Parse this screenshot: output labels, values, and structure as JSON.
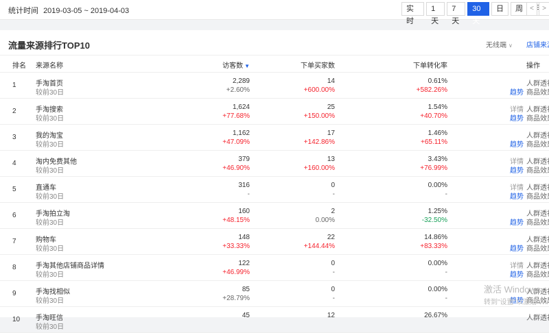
{
  "topbar": {
    "time_label": "统计时间",
    "time_range": "2019-03-05 ~ 2019-04-03",
    "range_buttons": [
      {
        "label": "实 时",
        "active": false
      },
      {
        "label": "1天",
        "active": false
      },
      {
        "label": "7天",
        "active": false
      },
      {
        "label": "30天",
        "active": true
      },
      {
        "label": "日",
        "active": false
      },
      {
        "label": "周",
        "active": false
      },
      {
        "label": "月",
        "active": false
      }
    ],
    "prev_arrow": "<",
    "next_arrow": ">"
  },
  "panel": {
    "title": "流量来源排行TOP10",
    "device_select": "无线端",
    "store_link": "店铺来源"
  },
  "table": {
    "headers": {
      "rank": "排名",
      "source": "来源名称",
      "visitors": "访客数",
      "buyers": "下单买家数",
      "conversion": "下单转化率",
      "ops": "操作"
    },
    "rows": [
      {
        "rank": "1",
        "name": "手淘首页",
        "sub": "较前30日",
        "visitors": "2,289",
        "visitors_change": "+2.60%",
        "visitors_trend": "neutral",
        "buyers": "14",
        "buyers_change": "+600.00%",
        "buyers_trend": "up",
        "conv": "0.61%",
        "conv_change": "+582.26%",
        "conv_trend": "up",
        "op_detail": "",
        "op_trend": "趋势",
        "op_crowd": "人群透视",
        "op_goods": "商品效果"
      },
      {
        "rank": "2",
        "name": "手淘搜索",
        "sub": "较前30日",
        "visitors": "1,624",
        "visitors_change": "+77.68%",
        "visitors_trend": "up",
        "buyers": "25",
        "buyers_change": "+150.00%",
        "buyers_trend": "up",
        "conv": "1.54%",
        "conv_change": "+40.70%",
        "conv_trend": "up",
        "op_detail": "详情",
        "op_trend": "趋势",
        "op_crowd": "人群透视",
        "op_goods": "商品效果"
      },
      {
        "rank": "3",
        "name": "我的淘宝",
        "sub": "较前30日",
        "visitors": "1,162",
        "visitors_change": "+47.09%",
        "visitors_trend": "up",
        "buyers": "17",
        "buyers_change": "+142.86%",
        "buyers_trend": "up",
        "conv": "1.46%",
        "conv_change": "+65.11%",
        "conv_trend": "up",
        "op_detail": "",
        "op_trend": "趋势",
        "op_crowd": "人群透视",
        "op_goods": "商品效果"
      },
      {
        "rank": "4",
        "name": "淘内免费其他",
        "sub": "较前30日",
        "visitors": "379",
        "visitors_change": "+46.90%",
        "visitors_trend": "up",
        "buyers": "13",
        "buyers_change": "+160.00%",
        "buyers_trend": "up",
        "conv": "3.43%",
        "conv_change": "+76.99%",
        "conv_trend": "up",
        "op_detail": "详情",
        "op_trend": "趋势",
        "op_crowd": "人群透视",
        "op_goods": "商品效果"
      },
      {
        "rank": "5",
        "name": "直通车",
        "sub": "较前30日",
        "visitors": "316",
        "visitors_change": "-",
        "visitors_trend": "neutral",
        "buyers": "0",
        "buyers_change": "-",
        "buyers_trend": "neutral",
        "conv": "0.00%",
        "conv_change": "-",
        "conv_trend": "neutral",
        "op_detail": "详情",
        "op_trend": "趋势",
        "op_crowd": "人群透视",
        "op_goods": "商品效果"
      },
      {
        "rank": "6",
        "name": "手淘拍立淘",
        "sub": "较前30日",
        "visitors": "160",
        "visitors_change": "+48.15%",
        "visitors_trend": "up",
        "buyers": "2",
        "buyers_change": "0.00%",
        "buyers_trend": "neutral",
        "conv": "1.25%",
        "conv_change": "-32.50%",
        "conv_trend": "down",
        "op_detail": "",
        "op_trend": "趋势",
        "op_crowd": "人群透视",
        "op_goods": "商品效果"
      },
      {
        "rank": "7",
        "name": "购物车",
        "sub": "较前30日",
        "visitors": "148",
        "visitors_change": "+33.33%",
        "visitors_trend": "up",
        "buyers": "22",
        "buyers_change": "+144.44%",
        "buyers_trend": "up",
        "conv": "14.86%",
        "conv_change": "+83.33%",
        "conv_trend": "up",
        "op_detail": "",
        "op_trend": "趋势",
        "op_crowd": "人群透视",
        "op_goods": "商品效果"
      },
      {
        "rank": "8",
        "name": "手淘其他店铺商品详情",
        "sub": "较前30日",
        "visitors": "122",
        "visitors_change": "+46.99%",
        "visitors_trend": "up",
        "buyers": "0",
        "buyers_change": "-",
        "buyers_trend": "neutral",
        "conv": "0.00%",
        "conv_change": "-",
        "conv_trend": "neutral",
        "op_detail": "详情",
        "op_trend": "趋势",
        "op_crowd": "人群透视",
        "op_goods": "商品效果"
      },
      {
        "rank": "9",
        "name": "手淘找相似",
        "sub": "较前30日",
        "visitors": "85",
        "visitors_change": "+28.79%",
        "visitors_trend": "neutral",
        "buyers": "0",
        "buyers_change": "-",
        "buyers_trend": "neutral",
        "conv": "0.00%",
        "conv_change": "-",
        "conv_trend": "neutral",
        "op_detail": "",
        "op_trend": "趋势",
        "op_crowd": "人群透视",
        "op_goods": "商品效果"
      },
      {
        "rank": "10",
        "name": "手淘旺信",
        "sub": "较前30日",
        "visitors": "45",
        "visitors_change": "",
        "visitors_trend": "neutral",
        "buyers": "12",
        "buyers_change": "",
        "buyers_trend": "neutral",
        "conv": "26.67%",
        "conv_change": "",
        "conv_trend": "neutral",
        "op_detail": "",
        "op_trend": "",
        "op_crowd": "人群透视",
        "op_goods": ""
      }
    ]
  },
  "watermark": {
    "line1": "激活 Windows",
    "line2": "转到\"设置\"以激活 Windows。"
  }
}
